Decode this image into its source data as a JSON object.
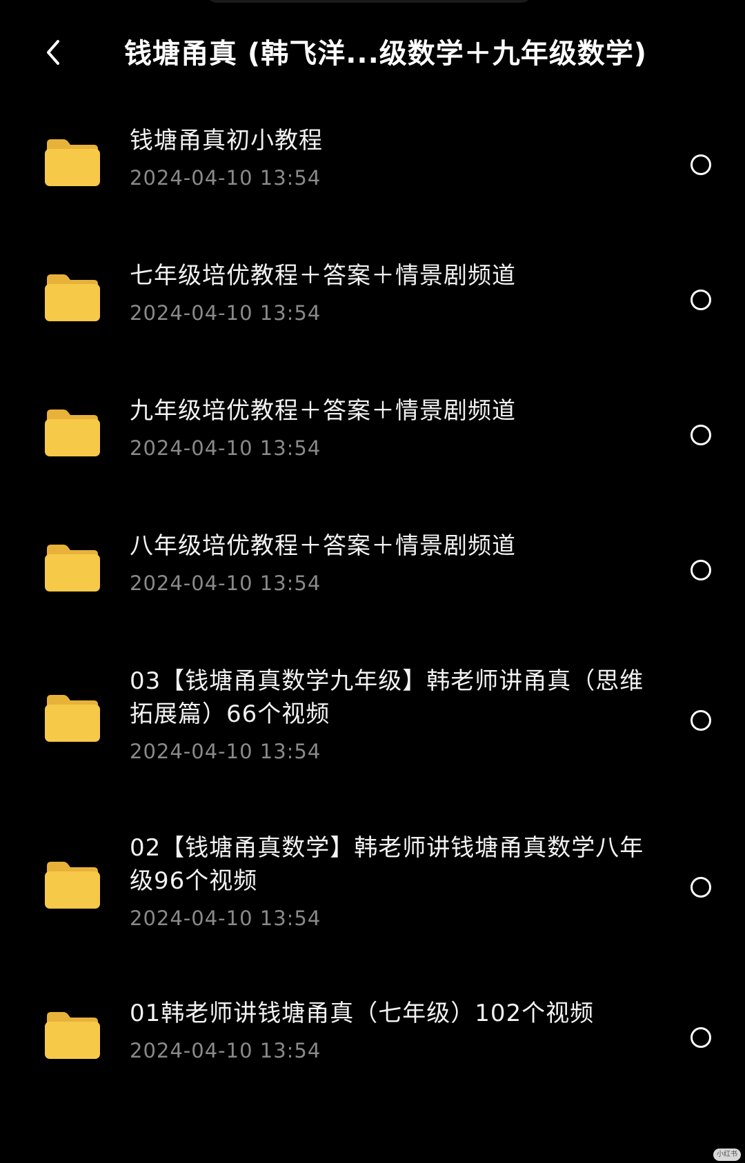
{
  "header": {
    "title": "钱塘甬真 (韩飞洋...级数学＋九年级数学)",
    "back_icon": "chevron-left-icon"
  },
  "folders": [
    {
      "name": "钱塘甬真初小教程",
      "date": "2024-04-10 13:54"
    },
    {
      "name": "七年级培优教程＋答案＋情景剧频道",
      "date": "2024-04-10 13:54"
    },
    {
      "name": "九年级培优教程＋答案＋情景剧频道",
      "date": "2024-04-10 13:54"
    },
    {
      "name": "八年级培优教程＋答案＋情景剧频道",
      "date": "2024-04-10 13:54"
    },
    {
      "name": "03【钱塘甬真数学九年级】韩老师讲甬真（思维拓展篇）66个视频",
      "date": "2024-04-10 13:54"
    },
    {
      "name": "02【钱塘甬真数学】韩老师讲钱塘甬真数学八年级96个视频",
      "date": "2024-04-10 13:54"
    },
    {
      "name": "01韩老师讲钱塘甬真（七年级）102个视频",
      "date": "2024-04-10 13:54"
    }
  ],
  "colors": {
    "background": "#000000",
    "folder": "#f7c948",
    "date_text": "#8a8a8a"
  },
  "watermark": "小红书"
}
